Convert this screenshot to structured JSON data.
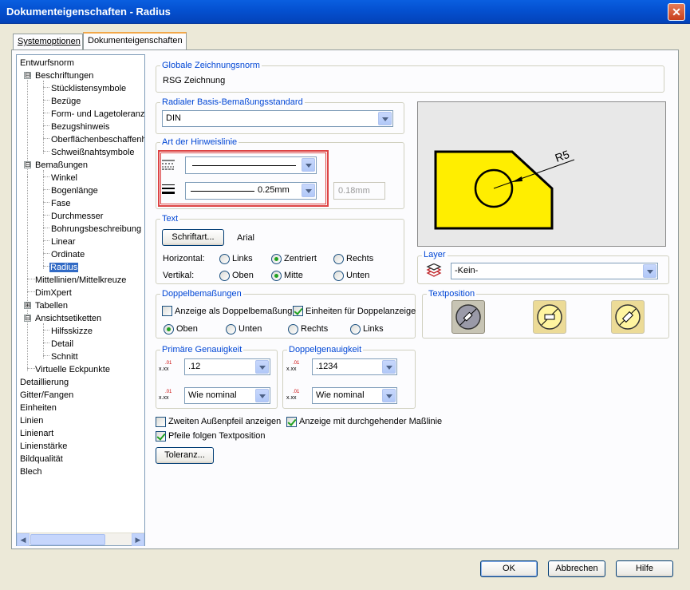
{
  "window": {
    "title": "Dokumenteigenschaften - Radius",
    "close_symbol": "✕"
  },
  "tabs": [
    {
      "label": "Systemoptionen"
    },
    {
      "label": "Dokumenteigenschaften"
    }
  ],
  "tree": {
    "items": [
      {
        "label": "Entwurfsnorm"
      },
      {
        "label": "Beschriftungen",
        "expander": "⊟"
      },
      {
        "label": "Stücklistensymbole"
      },
      {
        "label": "Bezüge"
      },
      {
        "label": "Form- und Lagetoleranzen"
      },
      {
        "label": "Bezugshinweis"
      },
      {
        "label": "Oberflächenbeschaffenheit"
      },
      {
        "label": "Schweißnahtsymbole"
      },
      {
        "label": "Bemaßungen",
        "expander": "⊟"
      },
      {
        "label": "Winkel"
      },
      {
        "label": "Bogenlänge"
      },
      {
        "label": "Fase"
      },
      {
        "label": "Durchmesser"
      },
      {
        "label": "Bohrungsbeschreibung"
      },
      {
        "label": "Linear"
      },
      {
        "label": "Ordinate"
      },
      {
        "label": "Radius",
        "selected": true
      },
      {
        "label": "Mittellinien/Mittelkreuze"
      },
      {
        "label": "DimXpert"
      },
      {
        "label": "Tabellen",
        "expander": "⊞"
      },
      {
        "label": "Ansichtsetiketten",
        "expander": "⊟"
      },
      {
        "label": "Hilfsskizze"
      },
      {
        "label": "Detail"
      },
      {
        "label": "Schnitt"
      },
      {
        "label": "Virtuelle Eckpunkte"
      },
      {
        "label": "Detaillierung"
      },
      {
        "label": "Gitter/Fangen"
      },
      {
        "label": "Einheiten"
      },
      {
        "label": "Linien"
      },
      {
        "label": "Linienart"
      },
      {
        "label": "Linienstärke"
      },
      {
        "label": "Bildqualität"
      },
      {
        "label": "Blech"
      }
    ]
  },
  "global_norm": {
    "label": "Globale Zeichnungsnorm",
    "value": "RSG Zeichnung"
  },
  "radial_std": {
    "label": "Radialer Basis-Bemaßungsstandard",
    "value": "DIN"
  },
  "leader": {
    "label": "Art der Hinweislinie",
    "thickness_value": "0.25mm",
    "custom_value": "0.18mm"
  },
  "preview": {
    "dim_text": "R5",
    "fill_color": "#ffee00"
  },
  "text": {
    "label": "Text",
    "font_button": "Schriftart...",
    "font_name": "Arial",
    "horizontal_label": "Horizontal:",
    "vertical_label": "Vertikal:",
    "h_options": [
      "Links",
      "Zentriert",
      "Rechts"
    ],
    "v_options": [
      "Oben",
      "Mitte",
      "Unten"
    ],
    "h_selected": "Zentriert",
    "v_selected": "Mitte"
  },
  "layer": {
    "label": "Layer",
    "value": "-Kein-"
  },
  "dual": {
    "label": "Doppelbemaßungen",
    "show_dual": "Anzeige als Doppelbemaßung",
    "units_dual": "Einheiten für Doppelanzeige",
    "positions": [
      "Oben",
      "Unten",
      "Rechts",
      "Links"
    ],
    "selected": "Oben"
  },
  "text_position": {
    "label": "Textposition"
  },
  "primary_precision": {
    "label": "Primäre Genauigkeit",
    "value1": ".12",
    "value2": "Wie nominal"
  },
  "dual_precision": {
    "label": "Doppelgenauigkeit",
    "value1": ".1234",
    "value2": "Wie nominal"
  },
  "options": {
    "second_arrow": "Zweiten Außenpfeil anzeigen",
    "continuous_line": "Anzeige mit durchgehender Maßlinie",
    "arrows_follow": "Pfeile folgen Textposition",
    "tolerance_button": "Toleranz..."
  },
  "footer": {
    "ok": "OK",
    "cancel": "Abbrechen",
    "help": "Hilfe"
  }
}
